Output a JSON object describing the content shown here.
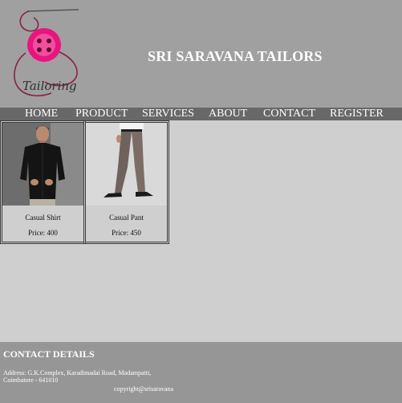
{
  "header": {
    "site_title": "SRI SARAVANA TAILORS",
    "logo_text": "Tailoring",
    "logo_colors": {
      "accent": "#e8157f",
      "thread": "#8a1f4a"
    }
  },
  "nav": {
    "items": [
      {
        "label": "HOME"
      },
      {
        "label": "PRODUCT"
      },
      {
        "label": "SERVICES"
      },
      {
        "label": "ABOUT"
      },
      {
        "label": "CONTACT"
      },
      {
        "label": "REGISTER"
      }
    ]
  },
  "products": [
    {
      "name": "Casual Shirt",
      "price": "Price: 400"
    },
    {
      "name": "Casual Pant",
      "price": "Price: 450"
    }
  ],
  "footer": {
    "heading": "CONTACT DETAILS",
    "address": "Address: G.K.Complex, Karadimadai Road, Madampatti, Coimbatore - 641010",
    "copyright": "copyright@srisaravana"
  },
  "colors": {
    "header_bg": "#a0a0a0",
    "nav_bg": "#686868",
    "main_bg": "#cfcfcf",
    "footer_bg": "#969696"
  }
}
